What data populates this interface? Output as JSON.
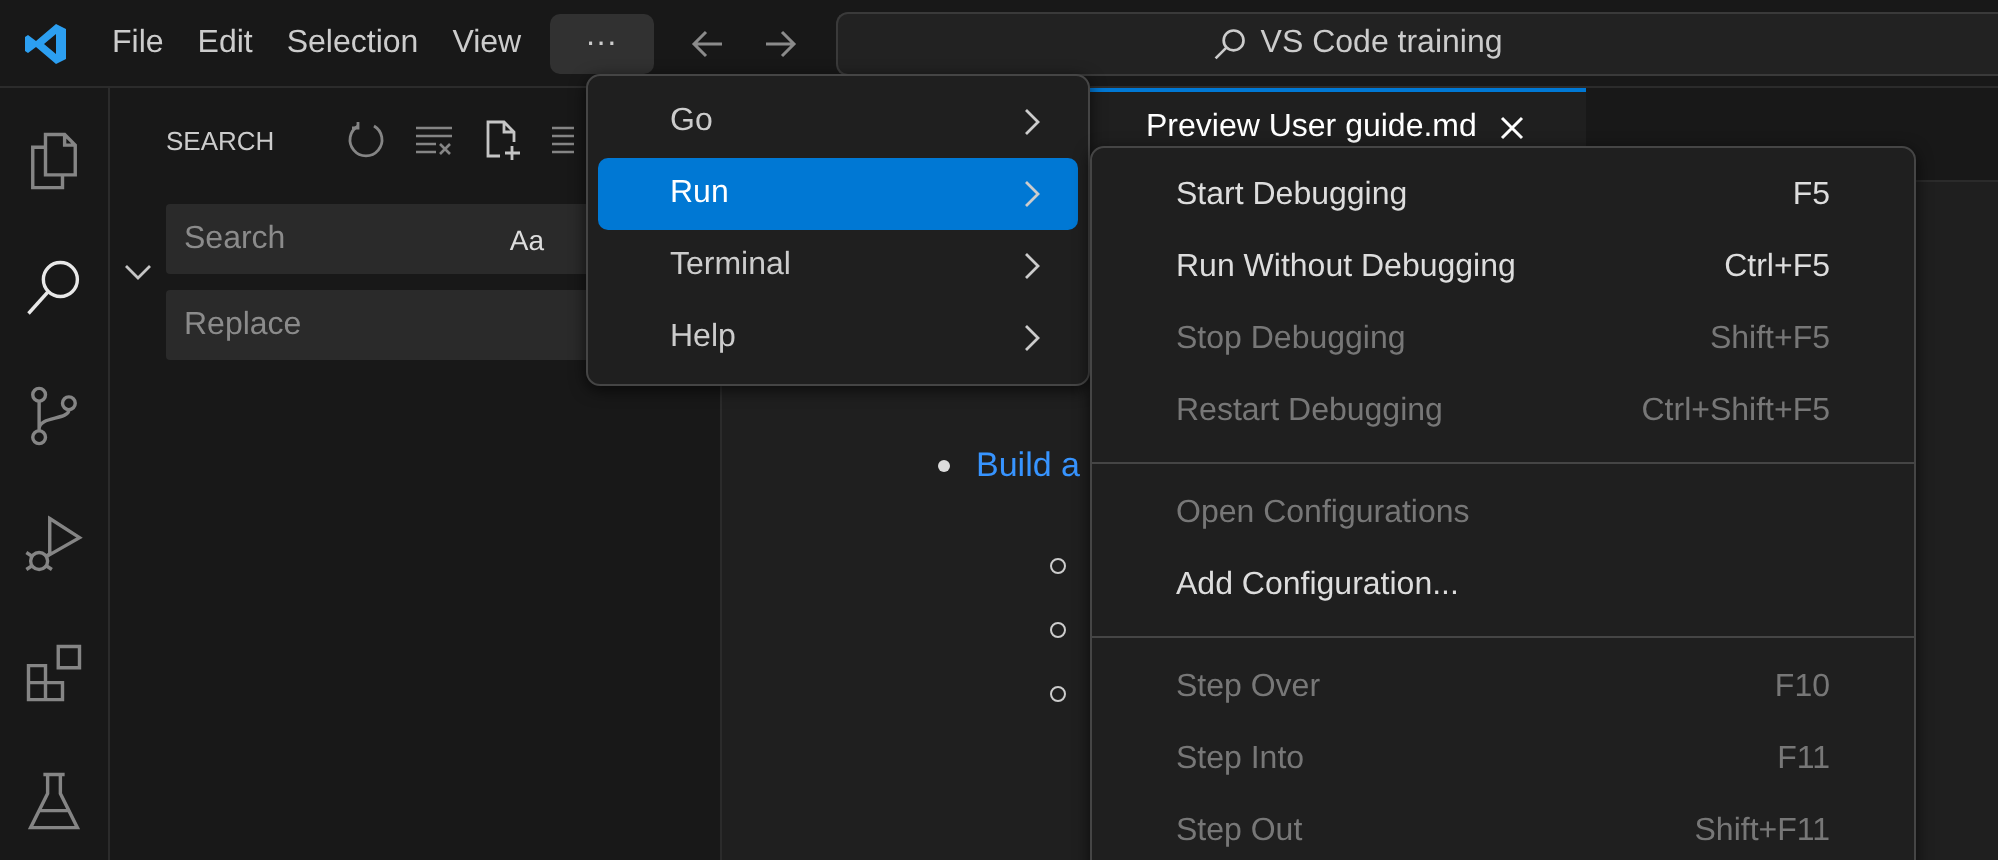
{
  "menubar": {
    "items": [
      {
        "label": "File"
      },
      {
        "label": "Edit"
      },
      {
        "label": "Selection"
      },
      {
        "label": "View"
      }
    ],
    "more": {
      "label": "···",
      "selected": true
    }
  },
  "command_center": {
    "label": "VS Code training"
  },
  "activity_bar": {
    "items": [
      {
        "kind": "explorer",
        "selected": false
      },
      {
        "kind": "search",
        "selected": true
      },
      {
        "kind": "source-control",
        "selected": false
      },
      {
        "kind": "run-debug",
        "selected": false
      },
      {
        "kind": "extensions",
        "selected": false
      },
      {
        "kind": "testing",
        "selected": false
      }
    ]
  },
  "sidebar": {
    "title": "SEARCH",
    "replace_expanded": true,
    "search_field": {
      "placeholder": "Search",
      "toggle": "Aa"
    },
    "replace_field": {
      "placeholder": "Replace"
    }
  },
  "tab": {
    "label": "Preview User guide.md",
    "selected": true
  },
  "editor": {
    "items": [
      {
        "text": "Build a",
        "kind": "link",
        "children": [
          {
            "kind": "bullet"
          },
          {
            "kind": "bullet"
          },
          {
            "kind": "bullet"
          }
        ]
      }
    ]
  },
  "menu": {
    "items": [
      {
        "label": "Go",
        "selected": false
      },
      {
        "label": "Run",
        "selected": true
      },
      {
        "label": "Terminal",
        "selected": false
      },
      {
        "label": "Help",
        "selected": false
      }
    ]
  },
  "submenu": {
    "groups": [
      {
        "items": [
          {
            "label": "Start Debugging",
            "shortcut": "F5",
            "disabled": false
          },
          {
            "label": "Run Without Debugging",
            "shortcut": "Ctrl+F5",
            "disabled": false
          },
          {
            "label": "Stop Debugging",
            "shortcut": "Shift+F5",
            "disabled": true
          },
          {
            "label": "Restart Debugging",
            "shortcut": "Ctrl+Shift+F5",
            "disabled": true
          }
        ]
      },
      {
        "items": [
          {
            "label": "Open Configurations",
            "disabled": true
          },
          {
            "label": "Add Configuration...",
            "disabled": false
          }
        ]
      },
      {
        "items": [
          {
            "label": "Step Over",
            "shortcut": "F10",
            "disabled": true
          },
          {
            "label": "Step Into",
            "shortcut": "F11",
            "disabled": true
          },
          {
            "label": "Step Out",
            "shortcut": "Shift+F11",
            "disabled": true
          }
        ]
      }
    ]
  }
}
